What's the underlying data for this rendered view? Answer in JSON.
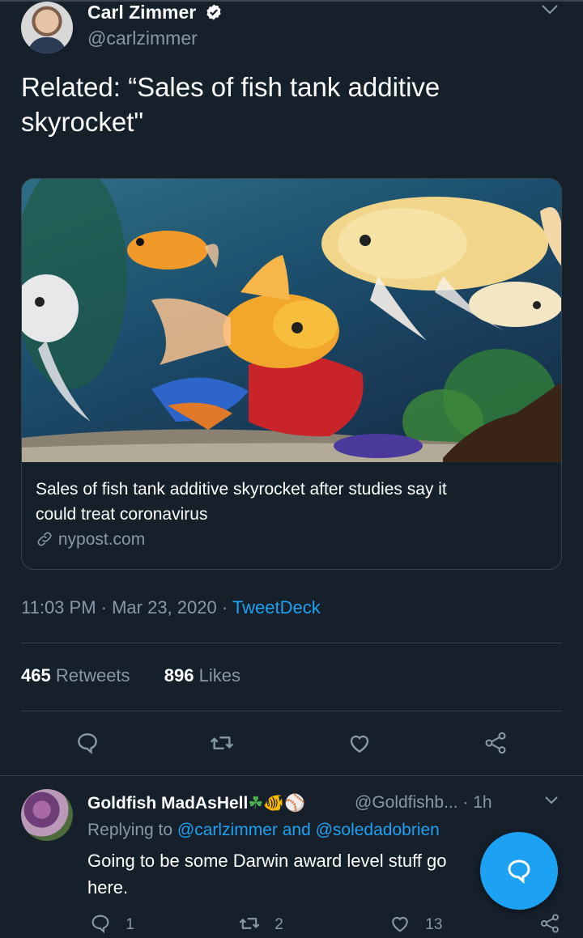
{
  "tweet": {
    "author_name": "Carl Zimmer",
    "author_handle": "@carlzimmer",
    "text_line1": "Related: “Sales of fish tank additive",
    "text_line2": "skyrocket\"",
    "card": {
      "title_line1": "Sales of fish tank additive skyrocket after studies say it",
      "title_line2": "could treat coronavirus",
      "source": "nypost.com"
    },
    "time": "11:03 PM · Mar 23, 2020 · ",
    "client": "TweetDeck",
    "retweets_count": "465",
    "retweets_label": " Retweets",
    "likes_count": "896",
    "likes_label": " Likes"
  },
  "reply": {
    "author_name": "Goldfish MadAsHell",
    "name_emojis": "☘🐠⚾",
    "author_handle": "@Goldfishb...",
    "time": " · 1h",
    "replying_prefix": "Replying to ",
    "replying_to": "@carlzimmer and @soledadobrien",
    "text_line1": "Going to be some Darwin award level stuff go",
    "text_line2": "here.",
    "reply_count": "1",
    "retweet_count": "2",
    "like_count": "13"
  },
  "icons": {
    "reply": "reply-icon",
    "retweet": "retweet-icon",
    "like": "heart-icon",
    "share": "share-icon",
    "verified": "verified-badge-icon",
    "link": "link-icon",
    "compose": "compose-reply-icon"
  },
  "colors": {
    "background": "#15202b",
    "accent": "#1da1f2",
    "muted": "#8899a6",
    "divider": "#38444d"
  }
}
